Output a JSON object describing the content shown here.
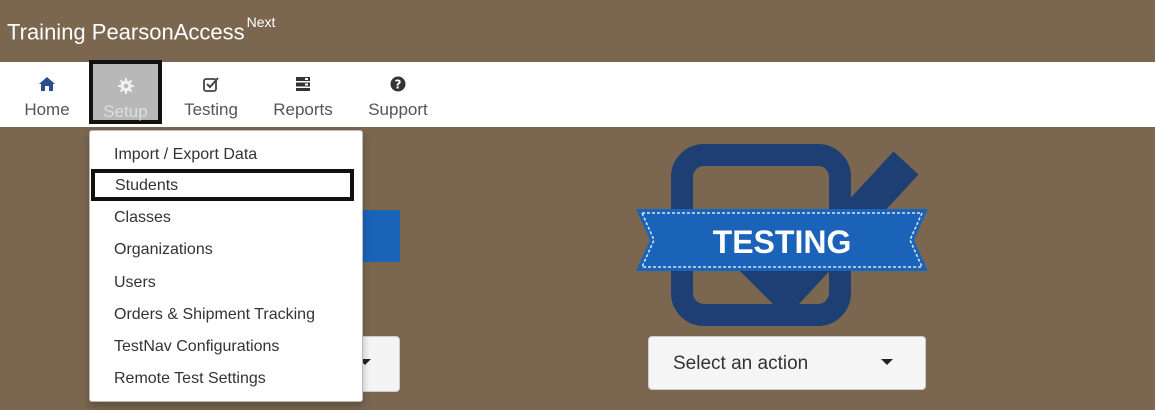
{
  "app": {
    "title": "Training PearsonAccess",
    "title_sup": "Next"
  },
  "nav": {
    "items": [
      {
        "label": "Home",
        "icon": "home-icon"
      },
      {
        "label": "Setup",
        "icon": "gear-icon"
      },
      {
        "label": "Testing",
        "icon": "checkbox-icon"
      },
      {
        "label": "Reports",
        "icon": "reports-icon"
      },
      {
        "label": "Support",
        "icon": "question-icon"
      }
    ]
  },
  "setup_menu": {
    "items": [
      "Import / Export Data",
      "Students",
      "Classes",
      "Organizations",
      "Users",
      "Orders & Shipment Tracking",
      "TestNav Configurations",
      "Remote Test Settings"
    ]
  },
  "testing_panel": {
    "ribbon_label": "TESTING",
    "select_label": "Select an action"
  },
  "colors": {
    "header_bg": "#7b6750",
    "brand_blue": "#1a63b8",
    "navy": "#1d3f73"
  }
}
